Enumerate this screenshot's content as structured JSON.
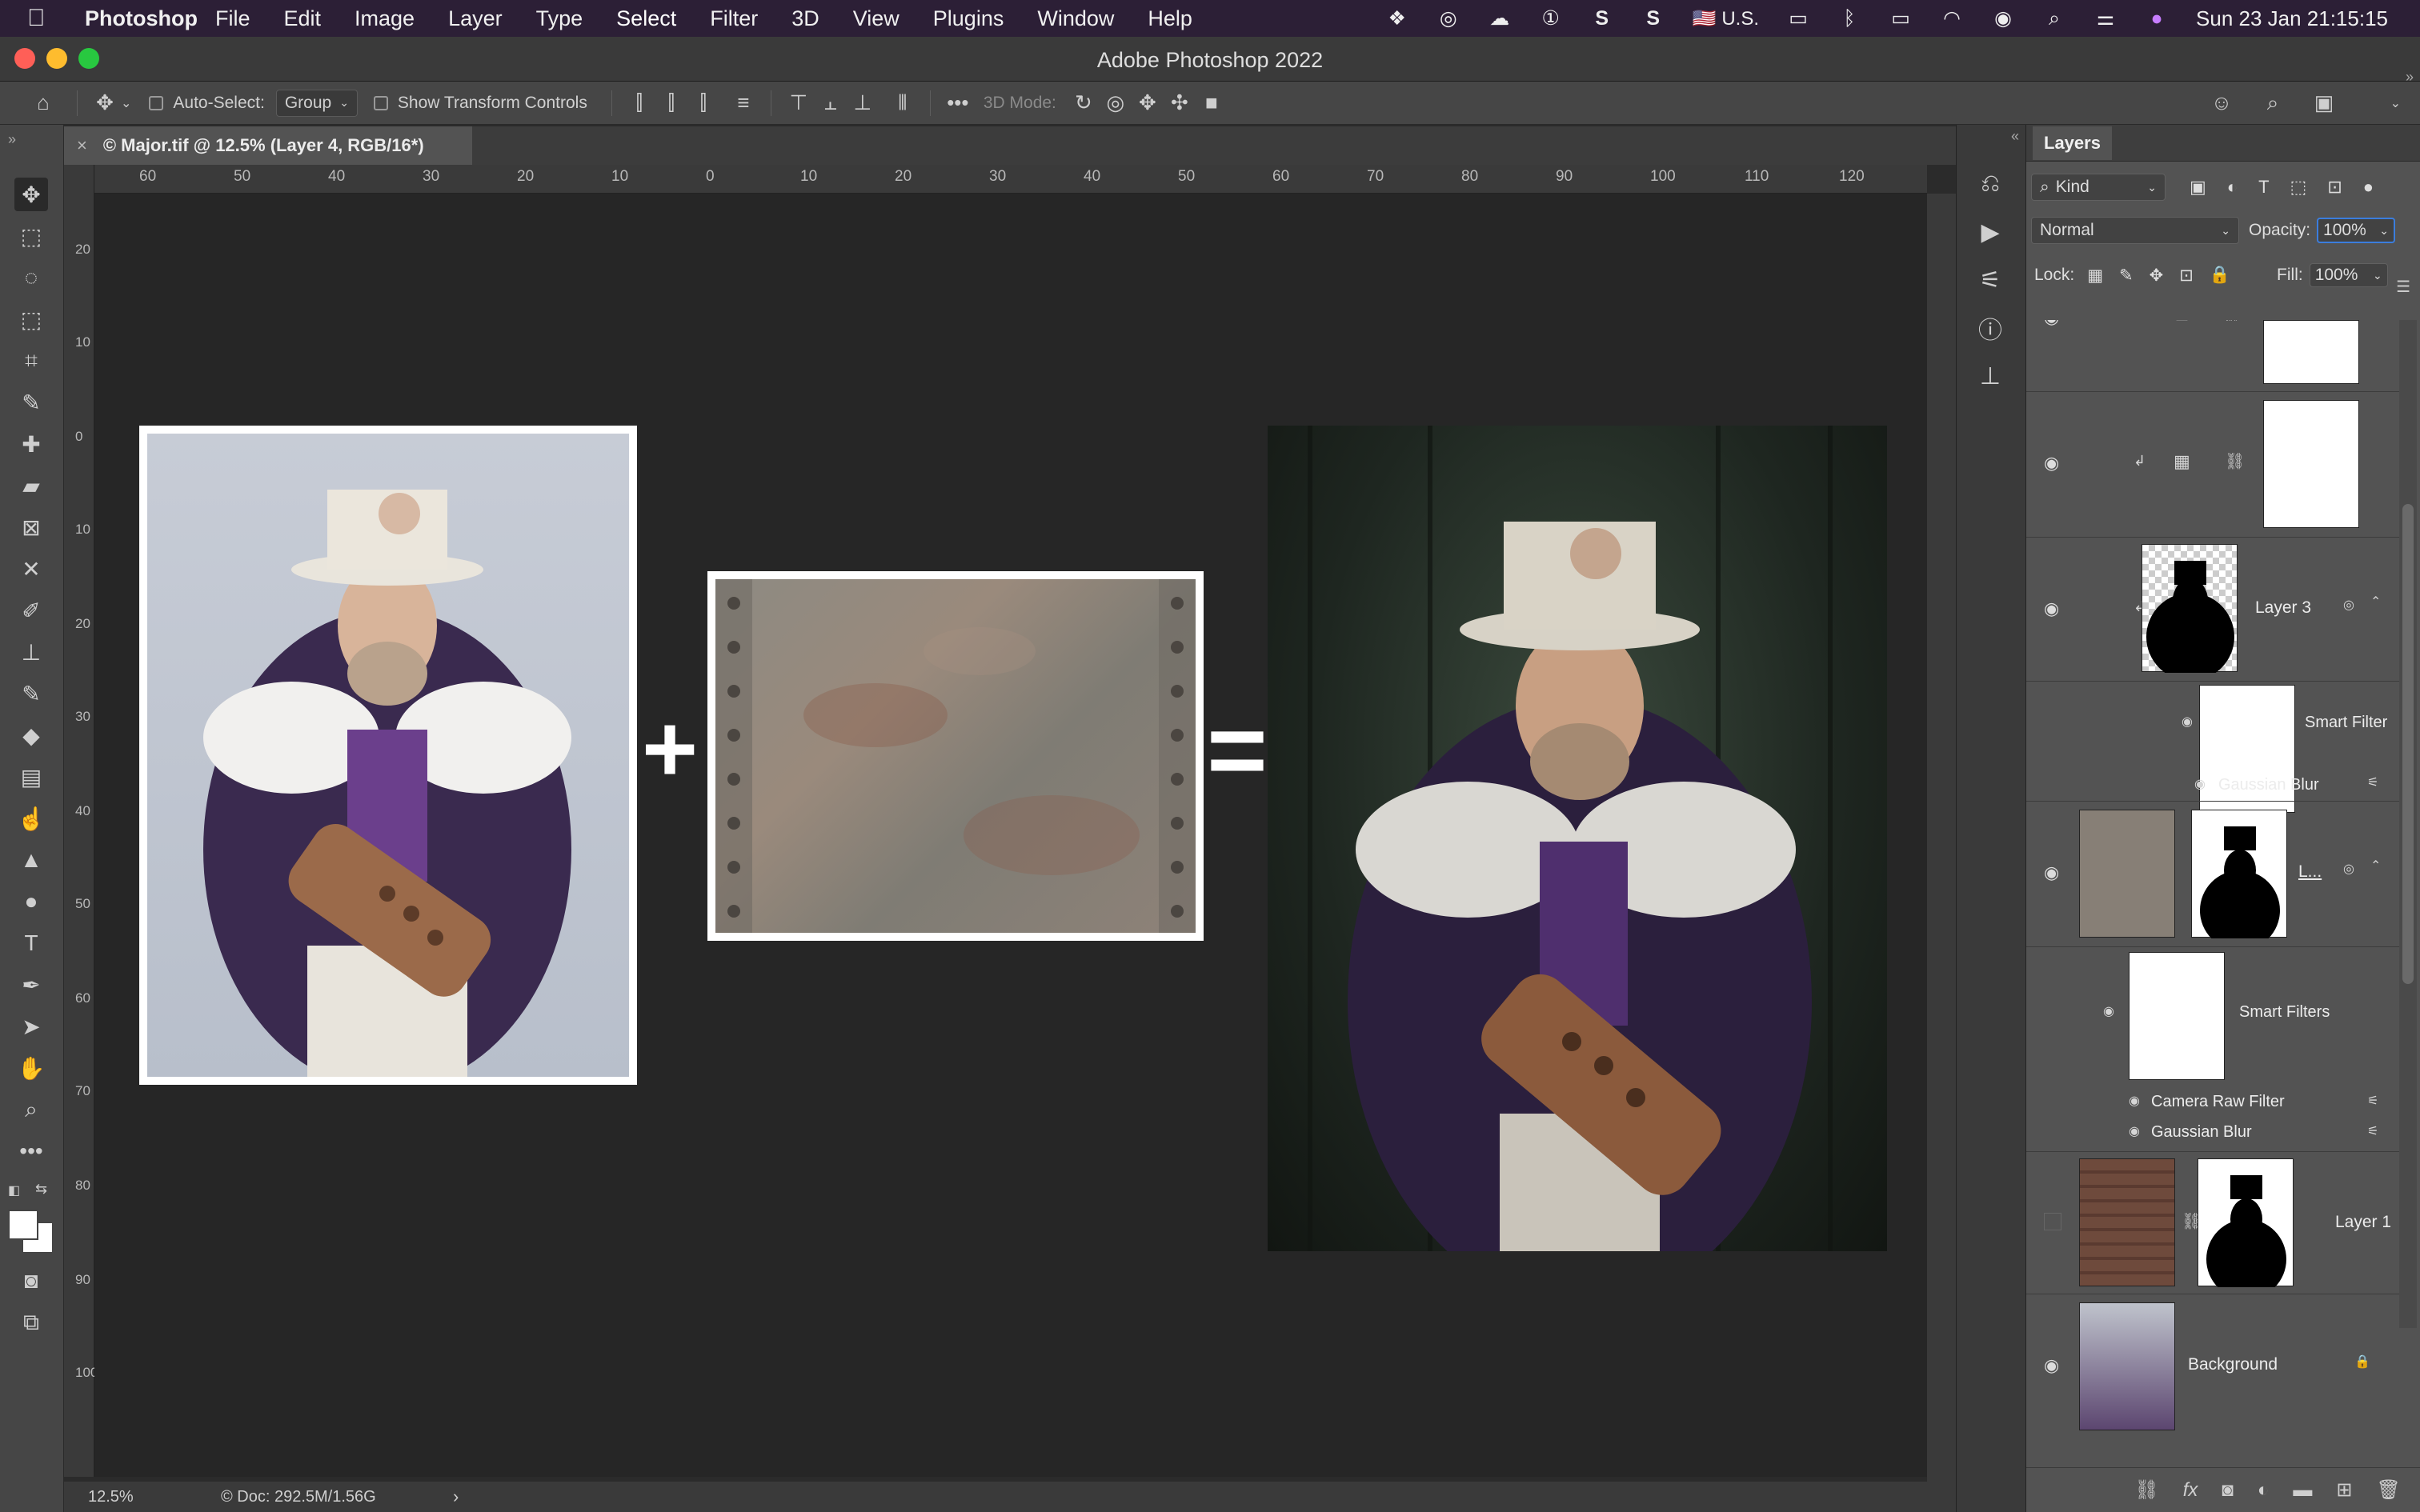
{
  "menubar": {
    "app": "Photoshop",
    "items": [
      "File",
      "Edit",
      "Image",
      "Layer",
      "Type",
      "Select",
      "Filter",
      "3D",
      "View",
      "Plugins",
      "Window",
      "Help"
    ],
    "input_source": "U.S.",
    "clock": "Sun 23 Jan  21:15:15"
  },
  "window": {
    "title": "Adobe Photoshop 2022"
  },
  "options": {
    "auto_select_label": "Auto-Select:",
    "auto_select_value": "Group",
    "transform_label": "Show Transform Controls",
    "mode3d_label": "3D Mode:"
  },
  "document": {
    "tab_title": "© Major.tif @ 12.5% (Layer 4, RGB/16*)"
  },
  "ruler": {
    "top": [
      "60",
      "50",
      "40",
      "30",
      "20",
      "10",
      "0",
      "10",
      "20",
      "30",
      "40",
      "50",
      "60",
      "70",
      "80",
      "90",
      "100",
      "110",
      "120"
    ],
    "left": [
      "20",
      "10",
      "0",
      "10",
      "20",
      "30",
      "40",
      "50",
      "60",
      "70",
      "80",
      "90",
      "100"
    ]
  },
  "canvas": {
    "plus": "+",
    "equals": "="
  },
  "status": {
    "zoom": "12.5%",
    "doc": "© Doc: 292.5M/1.56G",
    "arrow": "›"
  },
  "layers": {
    "tab": "Layers",
    "filter": "Kind",
    "blend_mode": "Normal",
    "opacity_label": "Opacity:",
    "opacity_value": "100%",
    "lock_label": "Lock:",
    "fill_label": "Fill:",
    "fill_value": "100%",
    "rows": {
      "layer3": "Layer 3",
      "smart_filter": "Smart Filter",
      "gaussian1": "Gaussian Blur",
      "layer4_short": "L...",
      "smart_filters": "Smart Filters",
      "camera_raw": "Camera Raw Filter",
      "gaussian2": "Gaussian Blur",
      "layer1": "Layer 1",
      "background": "Background"
    }
  },
  "colors": {
    "menubar": "#2c1f36",
    "accent": "#3b7ddd",
    "panel": "#535353",
    "canvas": "#262626"
  }
}
